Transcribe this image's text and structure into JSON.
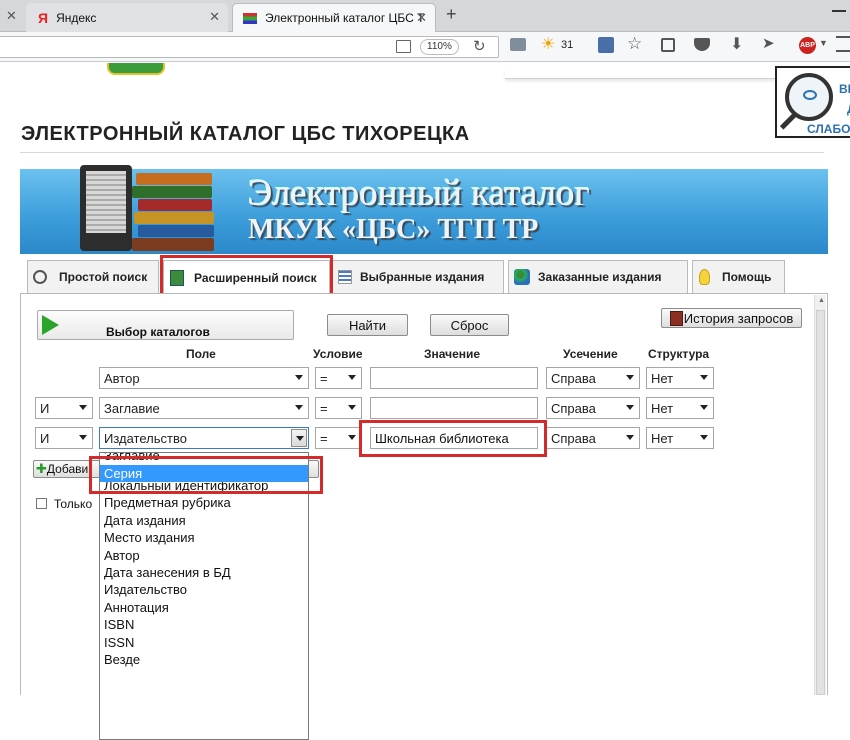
{
  "browser": {
    "tabs": [
      {
        "label": "Яндекс",
        "active": false
      },
      {
        "label": "Электронный каталог ЦБС Т",
        "active": true
      }
    ],
    "new_tab_symbol": "+",
    "zoom": "110%",
    "weather": "31"
  },
  "accessibility": {
    "line1": "ВЕ",
    "line2": "Д",
    "line3": "СЛАБО"
  },
  "site_title": "ЭЛЕКТРОННЫЙ КАТАЛОГ ЦБС ТИХОРЕЦКА",
  "banner": {
    "line1": "Электронный каталог",
    "line2": "МКУК «ЦБС» ТГП ТР"
  },
  "search_tabs": [
    {
      "label": "Простой поиск",
      "icon": "magnifier-icon"
    },
    {
      "label": "Расширенный поиск",
      "icon": "advanced-search-icon"
    },
    {
      "label": "Выбранные издания",
      "icon": "list-icon"
    },
    {
      "label": "Заказанные издания",
      "icon": "users-icon"
    },
    {
      "label": "Помощь",
      "icon": "lightbulb-icon"
    }
  ],
  "controls": {
    "catalog_select": "Выбор каталогов",
    "find": "Найти",
    "reset": "Сброс",
    "history": "История запросов",
    "add": "Добави",
    "only": "Только"
  },
  "columns": {
    "field": "Поле",
    "condition": "Условие",
    "value": "Значение",
    "truncation": "Усечение",
    "structure": "Структура"
  },
  "rows": [
    {
      "logic": "",
      "field": "Автор",
      "condition": "=",
      "value": "",
      "truncation": "Справа",
      "structure": "Нет"
    },
    {
      "logic": "И",
      "field": "Заглавие",
      "condition": "=",
      "value": "",
      "truncation": "Справа",
      "structure": "Нет"
    },
    {
      "logic": "И",
      "field": "Издательство",
      "condition": "=",
      "value": "Школьная библиотека",
      "truncation": "Справа",
      "structure": "Нет"
    }
  ],
  "dropdown_options": [
    "Заглавие",
    "Серия",
    "Локальный идентификатор",
    "Предметная рубрика",
    "Дата издания",
    "Место издания",
    "Автор",
    "Дата занесения в БД",
    "Издательство",
    "Аннотация",
    "ISBN",
    "ISSN",
    "Везде"
  ],
  "dropdown_selected": "Серия",
  "colors": {
    "highlight": "#3399ff",
    "annotation_red": "#d42a2a",
    "banner": "#3e9fdc"
  }
}
